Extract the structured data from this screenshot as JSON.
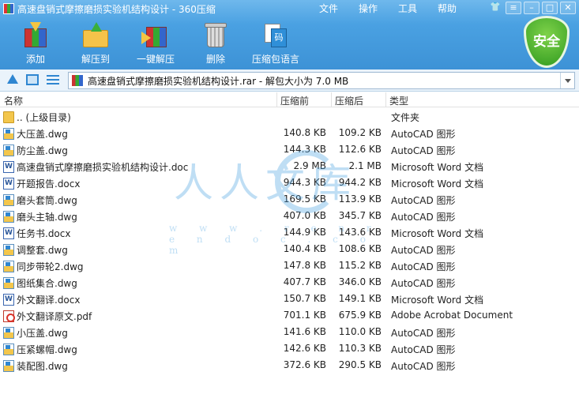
{
  "window": {
    "title": "高速盘销式摩擦磨损实验机结构设计 - 360压缩"
  },
  "menu": [
    "文件",
    "操作",
    "工具",
    "帮助"
  ],
  "toolbar": {
    "add": "添加",
    "extract": "解压到",
    "one_key": "一键解压",
    "delete": "删除",
    "language": "压缩包语言",
    "language_icon_text": "码",
    "security": "安全"
  },
  "address": {
    "path": "高速盘销式摩擦磨损实验机结构设计.rar - 解包大小为 7.0 MB"
  },
  "columns": {
    "name": "名称",
    "compressed_before": "压缩前",
    "compressed_after": "压缩后",
    "type": "类型"
  },
  "files": [
    {
      "name": ".. (上级目录)",
      "before": "",
      "after": "",
      "type": "文件夹",
      "icon": "folder-icon"
    },
    {
      "name": "大压盖.dwg",
      "before": "140.8 KB",
      "after": "109.2 KB",
      "type": "AutoCAD 图形",
      "icon": "dwg-icon"
    },
    {
      "name": "防尘盖.dwg",
      "before": "144.3 KB",
      "after": "112.6 KB",
      "type": "AutoCAD 图形",
      "icon": "dwg-icon"
    },
    {
      "name": "高速盘销式摩擦磨损实验机结构设计.doc",
      "before": "2.9 MB",
      "after": "2.1 MB",
      "type": "Microsoft Word 文档",
      "icon": "doc-icon"
    },
    {
      "name": "开题报告.docx",
      "before": "944.3 KB",
      "after": "944.2 KB",
      "type": "Microsoft Word 文档",
      "icon": "doc-icon"
    },
    {
      "name": "磨头套筒.dwg",
      "before": "169.5 KB",
      "after": "113.9 KB",
      "type": "AutoCAD 图形",
      "icon": "dwg-icon"
    },
    {
      "name": "磨头主轴.dwg",
      "before": "407.0 KB",
      "after": "345.7 KB",
      "type": "AutoCAD 图形",
      "icon": "dwg-icon"
    },
    {
      "name": "任务书.docx",
      "before": "144.9 KB",
      "after": "143.6 KB",
      "type": "Microsoft Word 文档",
      "icon": "doc-icon"
    },
    {
      "name": "调整套.dwg",
      "before": "140.4 KB",
      "after": "108.6 KB",
      "type": "AutoCAD 图形",
      "icon": "dwg-icon"
    },
    {
      "name": "同步带轮2.dwg",
      "before": "147.8 KB",
      "after": "115.2 KB",
      "type": "AutoCAD 图形",
      "icon": "dwg-icon"
    },
    {
      "name": "图纸集合.dwg",
      "before": "407.7 KB",
      "after": "346.0 KB",
      "type": "AutoCAD 图形",
      "icon": "dwg-icon"
    },
    {
      "name": "外文翻译.docx",
      "before": "150.7 KB",
      "after": "149.1 KB",
      "type": "Microsoft Word 文档",
      "icon": "doc-icon"
    },
    {
      "name": "外文翻译原文.pdf",
      "before": "701.1 KB",
      "after": "675.9 KB",
      "type": "Adobe Acrobat Document",
      "icon": "pdf-icon"
    },
    {
      "name": "小压盖.dwg",
      "before": "141.6 KB",
      "after": "110.0 KB",
      "type": "AutoCAD 图形",
      "icon": "dwg-icon"
    },
    {
      "name": "压紧螺帽.dwg",
      "before": "142.6 KB",
      "after": "110.3 KB",
      "type": "AutoCAD 图形",
      "icon": "dwg-icon"
    },
    {
      "name": "装配图.dwg",
      "before": "372.6 KB",
      "after": "290.5 KB",
      "type": "AutoCAD 图形",
      "icon": "dwg-icon"
    }
  ],
  "watermark": {
    "big": "人人文库",
    "small": "w w w . r e n r e n d o c . c o m"
  }
}
